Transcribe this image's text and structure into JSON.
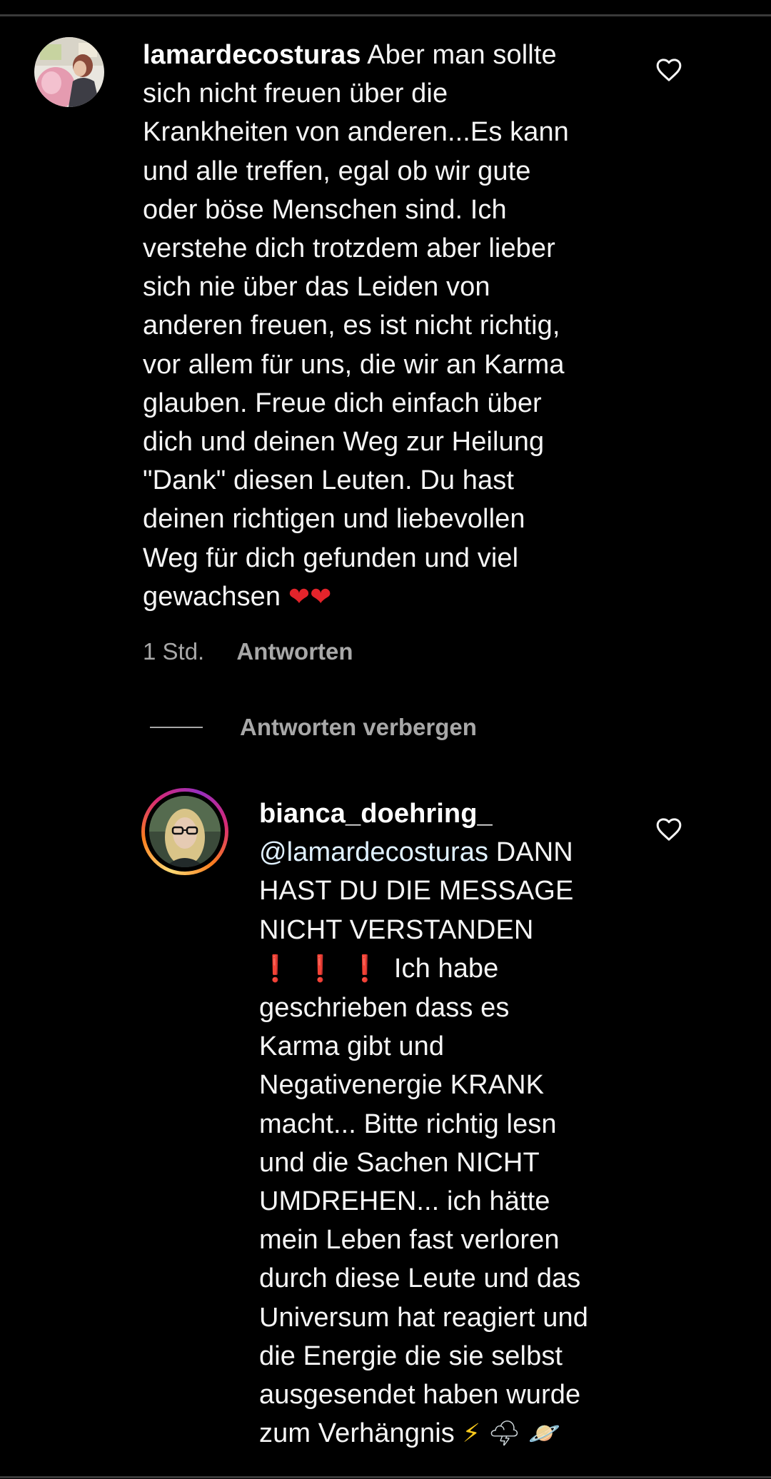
{
  "comments": [
    {
      "username": "lamardecosturas",
      "lines": [
        "Aber man sollte",
        "sich nicht freuen über die",
        "Krankheiten von anderen...Es kann",
        "und alle treffen, egal ob wir gute",
        "oder böse Menschen sind. Ich",
        "verstehe dich trotzdem aber lieber",
        "sich nie über das Leiden von",
        "anderen freuen, es ist nicht richtig,",
        "vor allem für uns, die wir an Karma",
        "glauben. Freue dich einfach über",
        "dich und deinen Weg zur Heilung",
        "\"Dank\" diesen Leuten. Du hast",
        "deinen richtigen und liebevollen",
        "Weg für dich gefunden und viel",
        "gewachsen"
      ],
      "end_emoji": "❤❤",
      "time": "1 Std.",
      "reply_label": "Antworten",
      "like_icon": "heart-outline-icon"
    },
    {
      "username": "bianca_doehring_",
      "mention": "@lamardecosturas",
      "lines": [
        "DANN",
        "HAST DU DIE MESSAGE",
        "NICHT VERSTANDEN",
        "Ich habe",
        "geschrieben dass es",
        "Karma gibt und",
        "Negativenergie KRANK",
        "macht... Bitte richtig lesn",
        "und die Sachen NICHT",
        "UMDREHEN... ich hätte",
        "mein Leben fast verloren",
        "durch diese Leute und das",
        "Universum hat reagiert und",
        "die Energie die sie selbst",
        "ausgesendet haben wurde",
        "zum Verhängnis"
      ],
      "exclamation_emoji": [
        "❗",
        "❗",
        "❗"
      ],
      "end_emoji": [
        "⚡",
        "🌩",
        "🪐"
      ],
      "like_icon": "heart-outline-icon"
    }
  ],
  "replies_toggle": {
    "label": "Antworten verbergen"
  },
  "colors": {
    "background": "#000000",
    "text": "#f5f5f5",
    "secondary_text": "#a8a8a8",
    "mention": "#e0f1ff",
    "heart": "#e3242b"
  }
}
